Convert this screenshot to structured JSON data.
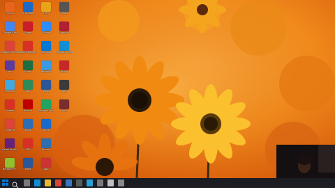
{
  "desktop": {
    "icons": [
      {
        "label": "Firefox",
        "color": "#e8641b"
      },
      {
        "label": "Google Site",
        "color": "#4285f4"
      },
      {
        "label": "Google Chrome",
        "color": "#db4437"
      },
      {
        "label": "App",
        "color": "#5c3b9c"
      },
      {
        "label": "Shortcut",
        "color": "#3fa9e0"
      },
      {
        "label": "Acrobat",
        "color": "#d93025"
      },
      {
        "label": "Chrome",
        "color": "#db4437"
      },
      {
        "label": "Visual Studio",
        "color": "#68217a"
      },
      {
        "label": "Notepad++",
        "color": "#90c030"
      },
      {
        "label": "VirtualBox",
        "color": "#1b6ac9"
      },
      {
        "label": "Opera",
        "color": "#cc1b2b"
      },
      {
        "label": "Adobe Reader",
        "color": "#d93025"
      },
      {
        "label": "Excel",
        "color": "#1d6f42"
      },
      {
        "label": "App",
        "color": "#2e8b57"
      },
      {
        "label": "Record",
        "color": "#c00000"
      },
      {
        "label": "Tools",
        "color": "#2d6db5"
      },
      {
        "label": "PDF",
        "color": "#d93025"
      },
      {
        "label": "Word",
        "color": "#2b579a"
      },
      {
        "label": "Files",
        "color": "#e8a317"
      },
      {
        "label": "Zoom",
        "color": "#2d8cff"
      },
      {
        "label": "Settings",
        "color": "#0078d4"
      },
      {
        "label": "Network",
        "color": "#3b9ae1"
      },
      {
        "label": "Word",
        "color": "#2b579a"
      },
      {
        "label": "Google Drive",
        "color": "#1fa463"
      },
      {
        "label": "Docs",
        "color": "#1b6ac9"
      },
      {
        "label": "Photos",
        "color": "#2f6fb1"
      },
      {
        "label": "App",
        "color": "#cc3333"
      },
      {
        "label": "Media",
        "color": "#555555"
      },
      {
        "label": "Shortcut",
        "color": "#b02030"
      },
      {
        "label": "Microsoft Edge",
        "color": "#0f8fd1"
      },
      {
        "label": "Utility",
        "color": "#c62828"
      },
      {
        "label": "App",
        "color": "#3a3a3a"
      },
      {
        "label": "App",
        "color": "#7a2d2d"
      }
    ]
  },
  "taskbar": {
    "items": [
      {
        "name": "task-view",
        "color": "#7a7a7a"
      },
      {
        "name": "edge",
        "color": "#0f8fd1"
      },
      {
        "name": "explorer",
        "color": "#e8b936"
      },
      {
        "name": "chrome",
        "color": "#db4437"
      },
      {
        "name": "app1",
        "color": "#3a76c4"
      },
      {
        "name": "app2",
        "color": "#5a5a5a"
      },
      {
        "name": "app3",
        "color": "#2c9fd8"
      },
      {
        "name": "app4",
        "color": "#7a7a7a"
      },
      {
        "name": "app5",
        "color": "#c0c0c0"
      },
      {
        "name": "app6",
        "color": "#8a8a8a"
      }
    ]
  },
  "colors": {
    "taskbar": "#1b1d22",
    "accent": "#0078d4",
    "wallpaper": "#f08a1c"
  }
}
